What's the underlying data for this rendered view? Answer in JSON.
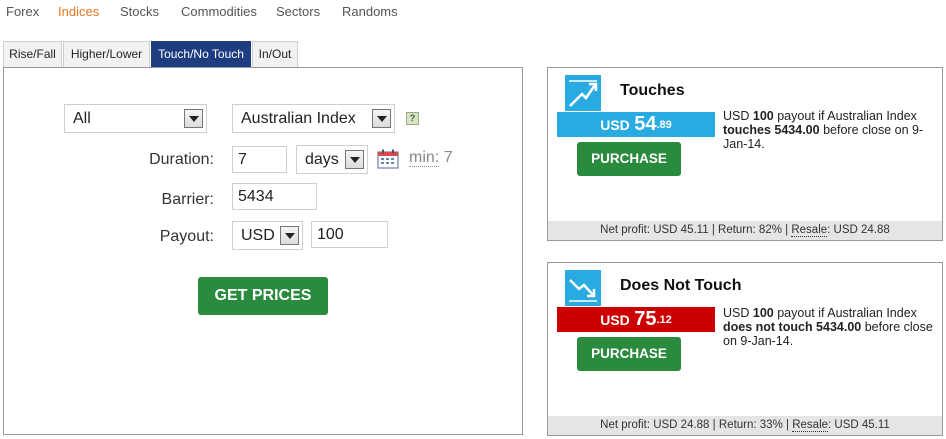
{
  "top_nav": [
    "Forex",
    "Indices",
    "Stocks",
    "Commodities",
    "Sectors",
    "Randoms"
  ],
  "top_nav_active": "Indices",
  "tabs": [
    "Rise/Fall",
    "Higher/Lower",
    "Touch/No Touch",
    "In/Out"
  ],
  "tabs_active": "Touch/No Touch",
  "form": {
    "category_select": "All",
    "underlying_select": "Australian Index",
    "duration_label": "Duration:",
    "duration_value": "7",
    "duration_unit": "days",
    "min_label": "min:",
    "min_value": "7",
    "barrier_label": "Barrier:",
    "barrier_value": "5434",
    "payout_label": "Payout:",
    "payout_currency": "USD",
    "payout_value": "100",
    "get_prices_button": "GET PRICES",
    "help_glyph": "?"
  },
  "contracts": [
    {
      "title": "Touches",
      "currency": "USD",
      "price_main": "54",
      "price_cents": ".89",
      "price_color": "#29aae1",
      "purchase_button": "PURCHASE",
      "desc_prefix": "USD",
      "desc_amount": "100",
      "desc_mid": "payout if Australian Index",
      "desc_bold": "touches 5434.00",
      "desc_end": "before close on 9-Jan-14.",
      "net_profit": "Net profit: USD 45.11",
      "return": "Return: 82%",
      "resale_label": "Resale",
      "resale_value": ": USD 24.88"
    },
    {
      "title": "Does Not Touch",
      "currency": "USD",
      "price_main": "75",
      "price_cents": ".12",
      "price_color": "#cc0000",
      "purchase_button": "PURCHASE",
      "desc_prefix": "USD",
      "desc_amount": "100",
      "desc_mid": "payout if Australian Index",
      "desc_bold": "does not touch 5434.00",
      "desc_end": "before close on 9-Jan-14.",
      "net_profit": "Net profit: USD 24.88",
      "return": "Return: 33%",
      "resale_label": "Resale",
      "resale_value": ": USD 45.11"
    }
  ],
  "separator": "|"
}
